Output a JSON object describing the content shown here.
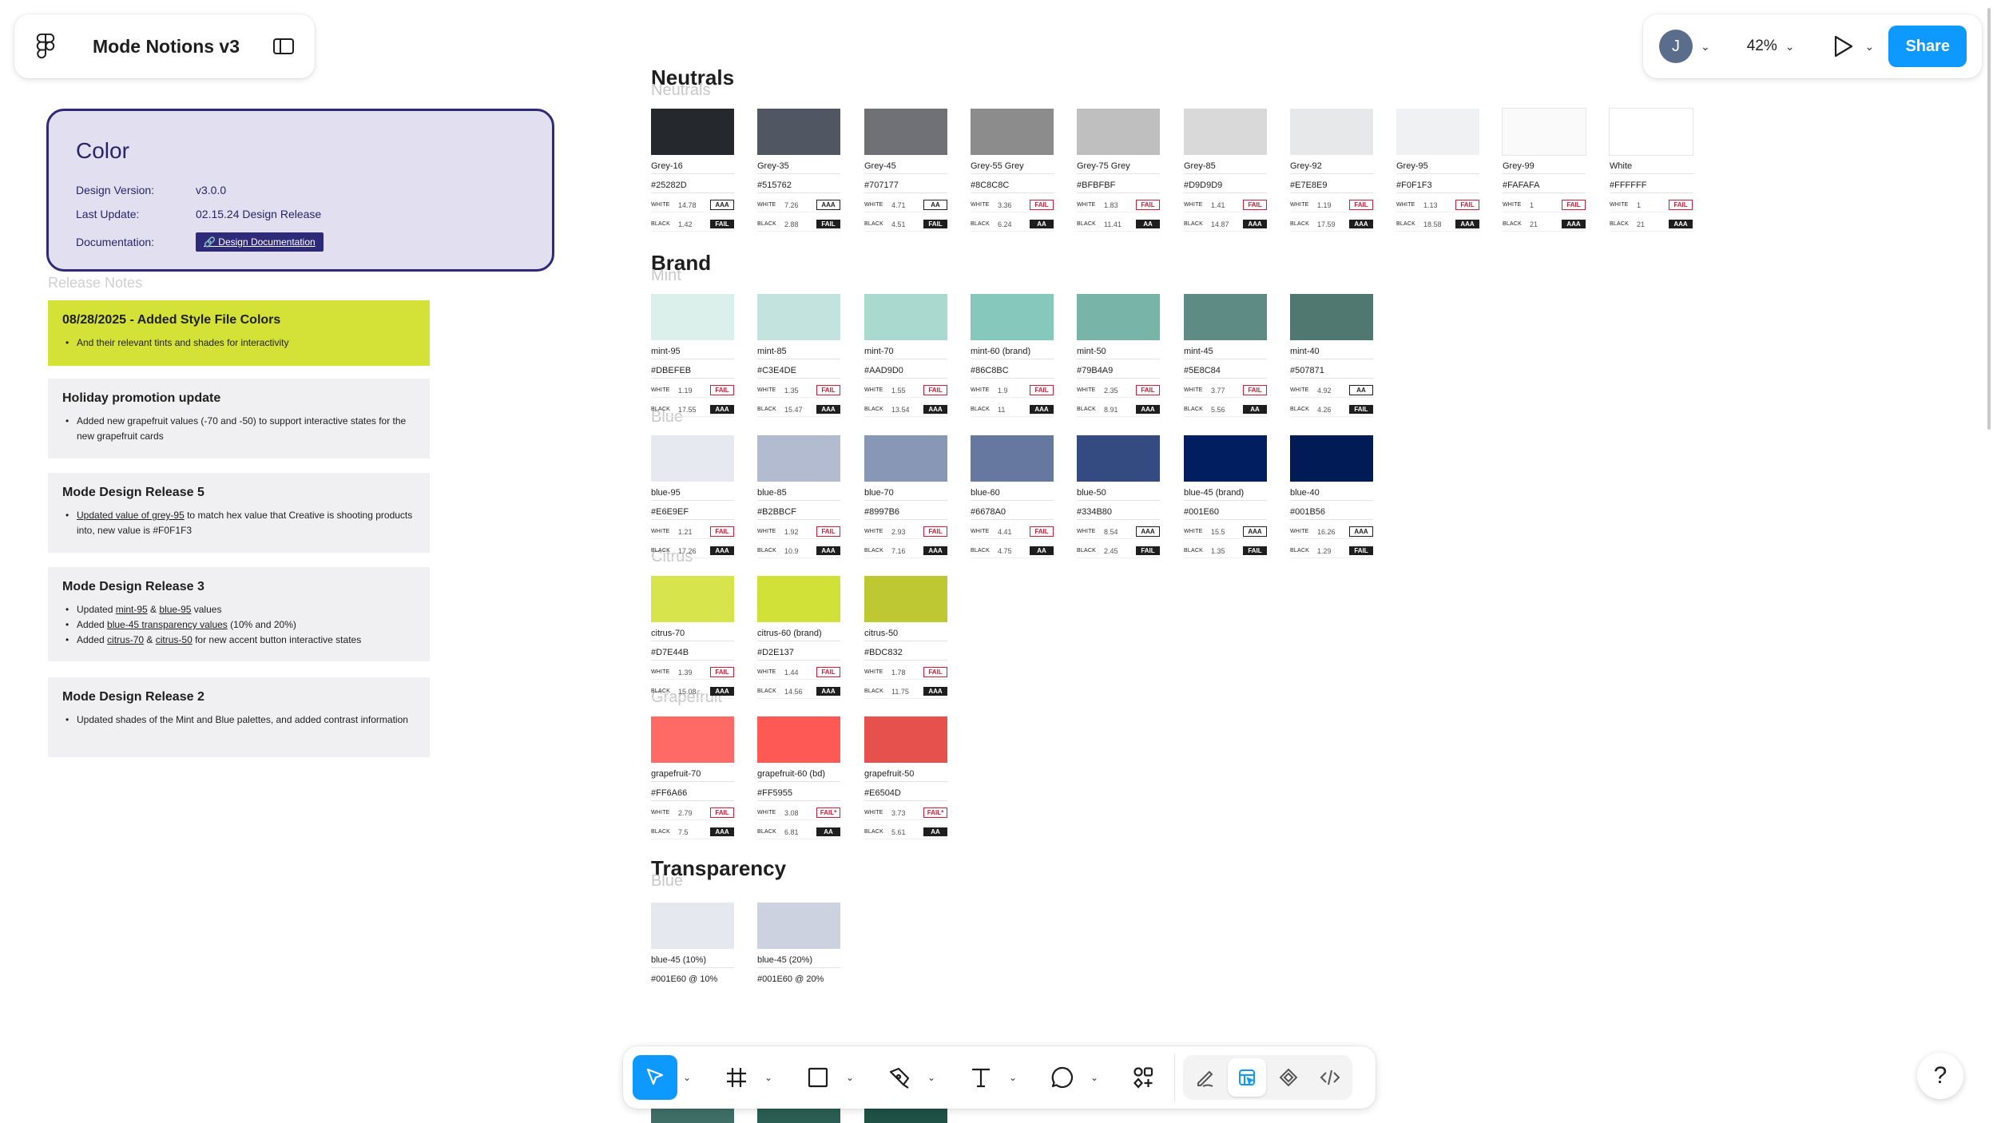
{
  "file": {
    "title": "Mode Notions v3"
  },
  "topbar": {
    "avatar_initial": "J",
    "zoom": "42%",
    "share_label": "Share"
  },
  "color_card": {
    "title": "Color",
    "design_version_label": "Design Version:",
    "design_version": "v3.0.0",
    "last_update_label": "Last Update:",
    "last_update": "02.15.24 Design Release",
    "documentation_label": "Documentation:",
    "documentation_link": "Design Documentation"
  },
  "release_notes": {
    "label": "Release Notes",
    "notes": [
      {
        "title": "08/28/2025 - Added Style File Colors",
        "items": [
          [
            {
              "t": "And their relevant tints and shades for interactivity"
            }
          ]
        ]
      },
      {
        "title": "Holiday promotion update",
        "items": [
          [
            {
              "t": "Added new grapefruit values (-70 and -50) to support interactive states for the new grapefruit cards"
            }
          ]
        ]
      },
      {
        "title": "Mode Design Release 5",
        "items": [
          [
            {
              "t": "Updated value of grey-95",
              "u": true
            },
            {
              "t": " to match hex value that Creative is shooting products into, new value is #F0F1F3"
            }
          ]
        ]
      },
      {
        "title": "Mode Design Release 3",
        "items": [
          [
            {
              "t": "Updated "
            },
            {
              "t": "mint-95",
              "u": true
            },
            {
              "t": " & "
            },
            {
              "t": "blue-95",
              "u": true
            },
            {
              "t": " values"
            }
          ],
          [
            {
              "t": "Added "
            },
            {
              "t": "blue-45 transparency values",
              "u": true
            },
            {
              "t": " (10% and 20%)"
            }
          ],
          [
            {
              "t": "Added "
            },
            {
              "t": "citrus-70",
              "u": true
            },
            {
              "t": " & "
            },
            {
              "t": "citrus-50",
              "u": true
            },
            {
              "t": " for new accent button interactive states"
            }
          ]
        ]
      },
      {
        "title": "Mode Design Release 2",
        "items": [
          [
            {
              "t": "Updated shades of the Mint and Blue palettes, and added contrast information"
            }
          ]
        ]
      }
    ]
  },
  "sections": {
    "neutrals": {
      "title": "Neutrals",
      "ghost": "Neutrals"
    },
    "brand": {
      "title": "Brand",
      "ghost_mint": "Mint",
      "ghost_blue": "Blue",
      "ghost_citrus": "Citrus",
      "ghost_grapefruit": "Grapefruit"
    },
    "transparency": {
      "title": "Transparency",
      "ghost": "Blue"
    }
  },
  "contrast_labels": {
    "white": "WHITE",
    "black": "BLACK"
  },
  "palettes": {
    "neutrals": [
      {
        "name": "Grey-16",
        "hex": "#25282D",
        "w": "14.78",
        "wb": "AAA",
        "b": "1.42",
        "bb": "FAIL"
      },
      {
        "name": "Grey-35",
        "hex": "#515762",
        "w": "7.26",
        "wb": "AAA",
        "b": "2.88",
        "bb": "FAIL"
      },
      {
        "name": "Grey-45",
        "hex": "#707177",
        "w": "4.71",
        "wb": "AA",
        "b": "4.51",
        "bb": "FAIL"
      },
      {
        "name": "Grey-55 Grey",
        "hex": "#8C8C8C",
        "w": "3.36",
        "wb": "FAIL",
        "b": "6.24",
        "bb": "AA"
      },
      {
        "name": "Grey-75 Grey",
        "hex": "#BFBFBF",
        "w": "1.83",
        "wb": "FAIL",
        "b": "11.41",
        "bb": "AA"
      },
      {
        "name": "Grey-85",
        "hex": "#D9D9D9",
        "w": "1.41",
        "wb": "FAIL",
        "b": "14.87",
        "bb": "AAA"
      },
      {
        "name": "Grey-92",
        "hex": "#E7E8E9",
        "w": "1.19",
        "wb": "FAIL",
        "b": "17.59",
        "bb": "AAA"
      },
      {
        "name": "Grey-95",
        "hex": "#F0F1F3",
        "w": "1.13",
        "wb": "FAIL",
        "b": "18.58",
        "bb": "AAA"
      },
      {
        "name": "Grey-99",
        "hex": "#FAFAFA",
        "w": "1",
        "wb": "FAIL",
        "b": "21",
        "bb": "AAA"
      },
      {
        "name": "White",
        "hex": "#FFFFFF",
        "w": "1",
        "wb": "FAIL",
        "b": "21",
        "bb": "AAA"
      }
    ],
    "mint": [
      {
        "name": "mint-95",
        "hex": "#DBEFEB",
        "w": "1.19",
        "wb": "FAIL",
        "b": "17.55",
        "bb": "AAA"
      },
      {
        "name": "mint-85",
        "hex": "#C3E4DE",
        "w": "1.35",
        "wb": "FAIL",
        "b": "15.47",
        "bb": "AAA"
      },
      {
        "name": "mint-70",
        "hex": "#AAD9D0",
        "w": "1.55",
        "wb": "FAIL",
        "b": "13.54",
        "bb": "AAA"
      },
      {
        "name": "mint-60 (brand)",
        "hex": "#86C8BC",
        "w": "1.9",
        "wb": "FAIL",
        "b": "11",
        "bb": "AAA"
      },
      {
        "name": "mint-50",
        "hex": "#79B4A9",
        "w": "2.35",
        "wb": "FAIL",
        "b": "8.91",
        "bb": "AAA"
      },
      {
        "name": "mint-45",
        "hex": "#5E8C84",
        "w": "3.77",
        "wb": "FAIL",
        "b": "5.56",
        "bb": "AA"
      },
      {
        "name": "mint-40",
        "hex": "#507871",
        "w": "4.92",
        "wb": "AA",
        "b": "4.26",
        "bb": "FAIL"
      }
    ],
    "blue": [
      {
        "name": "blue-95",
        "hex": "#E6E9EF",
        "w": "1.21",
        "wb": "FAIL",
        "b": "17.26",
        "bb": "AAA"
      },
      {
        "name": "blue-85",
        "hex": "#B2BBCF",
        "w": "1.92",
        "wb": "FAIL",
        "b": "10.9",
        "bb": "AAA"
      },
      {
        "name": "blue-70",
        "hex": "#8997B6",
        "w": "2.93",
        "wb": "FAIL",
        "b": "7.16",
        "bb": "AAA"
      },
      {
        "name": "blue-60",
        "hex": "#6678A0",
        "w": "4.41",
        "wb": "FAIL",
        "b": "4.75",
        "bb": "AA"
      },
      {
        "name": "blue-50",
        "hex": "#334B80",
        "w": "8.54",
        "wb": "AAA",
        "b": "2.45",
        "bb": "FAIL"
      },
      {
        "name": "blue-45 (brand)",
        "hex": "#001E60",
        "w": "15.5",
        "wb": "AAA",
        "b": "1.35",
        "bb": "FAIL"
      },
      {
        "name": "blue-40",
        "hex": "#001B56",
        "w": "16.26",
        "wb": "AAA",
        "b": "1.29",
        "bb": "FAIL"
      }
    ],
    "citrus": [
      {
        "name": "citrus-70",
        "hex": "#D7E44B",
        "w": "1.39",
        "wb": "FAIL",
        "b": "15.08",
        "bb": "AAA"
      },
      {
        "name": "citrus-60 (brand)",
        "hex": "#D2E137",
        "w": "1.44",
        "wb": "FAIL",
        "b": "14.56",
        "bb": "AAA"
      },
      {
        "name": "citrus-50",
        "hex": "#BDC832",
        "w": "1.78",
        "wb": "FAIL",
        "b": "11.75",
        "bb": "AAA"
      }
    ],
    "grapefruit": [
      {
        "name": "grapefruit-70",
        "hex": "#FF6A66",
        "w": "2.79",
        "wb": "FAIL",
        "b": "7.5",
        "bb": "AAA"
      },
      {
        "name": "grapefruit-60 (bd)",
        "hex": "#FF5955",
        "w": "3.08",
        "wb": "FAIL*",
        "b": "6.81",
        "bb": "AA"
      },
      {
        "name": "grapefruit-50",
        "hex": "#E6504D",
        "w": "3.73",
        "wb": "FAIL*",
        "b": "5.61",
        "bb": "AA"
      }
    ],
    "transparency": [
      {
        "name": "blue-45 (10%)",
        "hex": "#001E60 @ 10%",
        "color": "#e6e8ef"
      },
      {
        "name": "blue-45 (20%)",
        "hex": "#001E60 @ 20%",
        "color": "#ccd2df"
      }
    ]
  },
  "peek_colors": [
    "#3f6e66",
    "#2a5e52",
    "#1f5146"
  ],
  "help_label": "?"
}
